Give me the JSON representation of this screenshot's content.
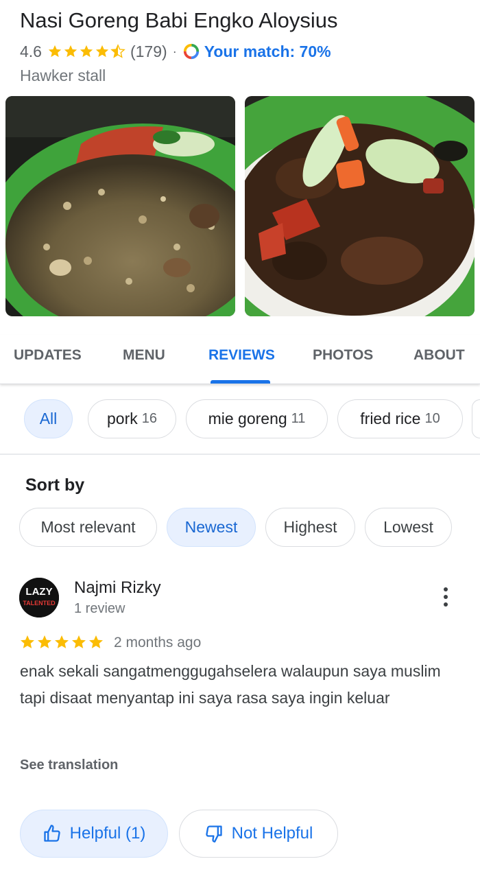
{
  "place": {
    "title": "Nasi Goreng Babi Engko Aloysius",
    "rating": "4.6",
    "review_count": "(179)",
    "separator": "·",
    "match_text": "Your match: 70%",
    "category": "Hawker stall"
  },
  "tabs": [
    {
      "label": "UPDATES"
    },
    {
      "label": "MENU"
    },
    {
      "label": "REVIEWS",
      "active": true
    },
    {
      "label": "PHOTOS"
    },
    {
      "label": "ABOUT"
    }
  ],
  "topic_chips": [
    {
      "label": "All",
      "count": "",
      "selected": true
    },
    {
      "label": "pork",
      "count": "16"
    },
    {
      "label": "mie goreng",
      "count": "11"
    },
    {
      "label": "fried rice",
      "count": "10"
    }
  ],
  "sort": {
    "heading": "Sort by",
    "options": [
      {
        "label": "Most relevant"
      },
      {
        "label": "Newest",
        "selected": true
      },
      {
        "label": "Highest"
      },
      {
        "label": "Lowest"
      }
    ]
  },
  "review": {
    "author": "Najmi Rizky",
    "author_meta": "1 review",
    "avatar_text_top": "LAZY",
    "avatar_text_bottom": "TALENTED",
    "stars": 5,
    "time": "2 months ago",
    "text": "enak sekali sangatmenggugahselera walaupun saya muslim tapi disaat menyantap ini saya rasa saya ingin keluar",
    "see_translation": "See translation",
    "helpful_label": "Helpful (1)",
    "not_helpful_label": "Not Helpful"
  },
  "colors": {
    "accent": "#1a73e8",
    "star": "#fbbc04",
    "chip_selected_bg": "#e8f0fe"
  }
}
